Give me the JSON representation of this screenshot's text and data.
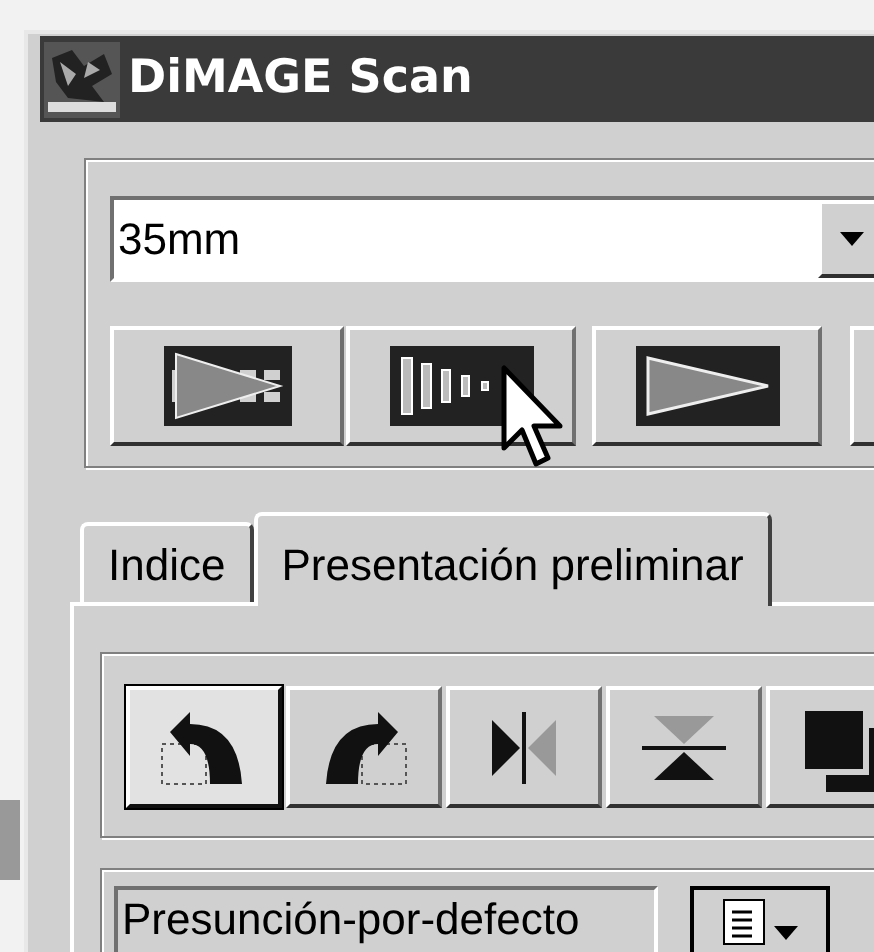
{
  "window": {
    "title": "DiMAGE Scan"
  },
  "film_type": {
    "value": "35mm"
  },
  "scan_buttons": [
    {
      "kind": "index-scan"
    },
    {
      "kind": "prescan"
    },
    {
      "kind": "scan"
    },
    {
      "kind": "cut-off"
    }
  ],
  "tabs": [
    {
      "label": "Indice",
      "selected": false
    },
    {
      "label": "Presentación preliminar",
      "selected": true
    }
  ],
  "tool_buttons": [
    {
      "kind": "rotate-left",
      "selected": true
    },
    {
      "kind": "rotate-right",
      "selected": false
    },
    {
      "kind": "flip-horizontal",
      "selected": false
    },
    {
      "kind": "flip-vertical",
      "selected": false
    },
    {
      "kind": "negative",
      "selected": false
    }
  ],
  "settings": {
    "value": "Presunción-por-defecto"
  }
}
